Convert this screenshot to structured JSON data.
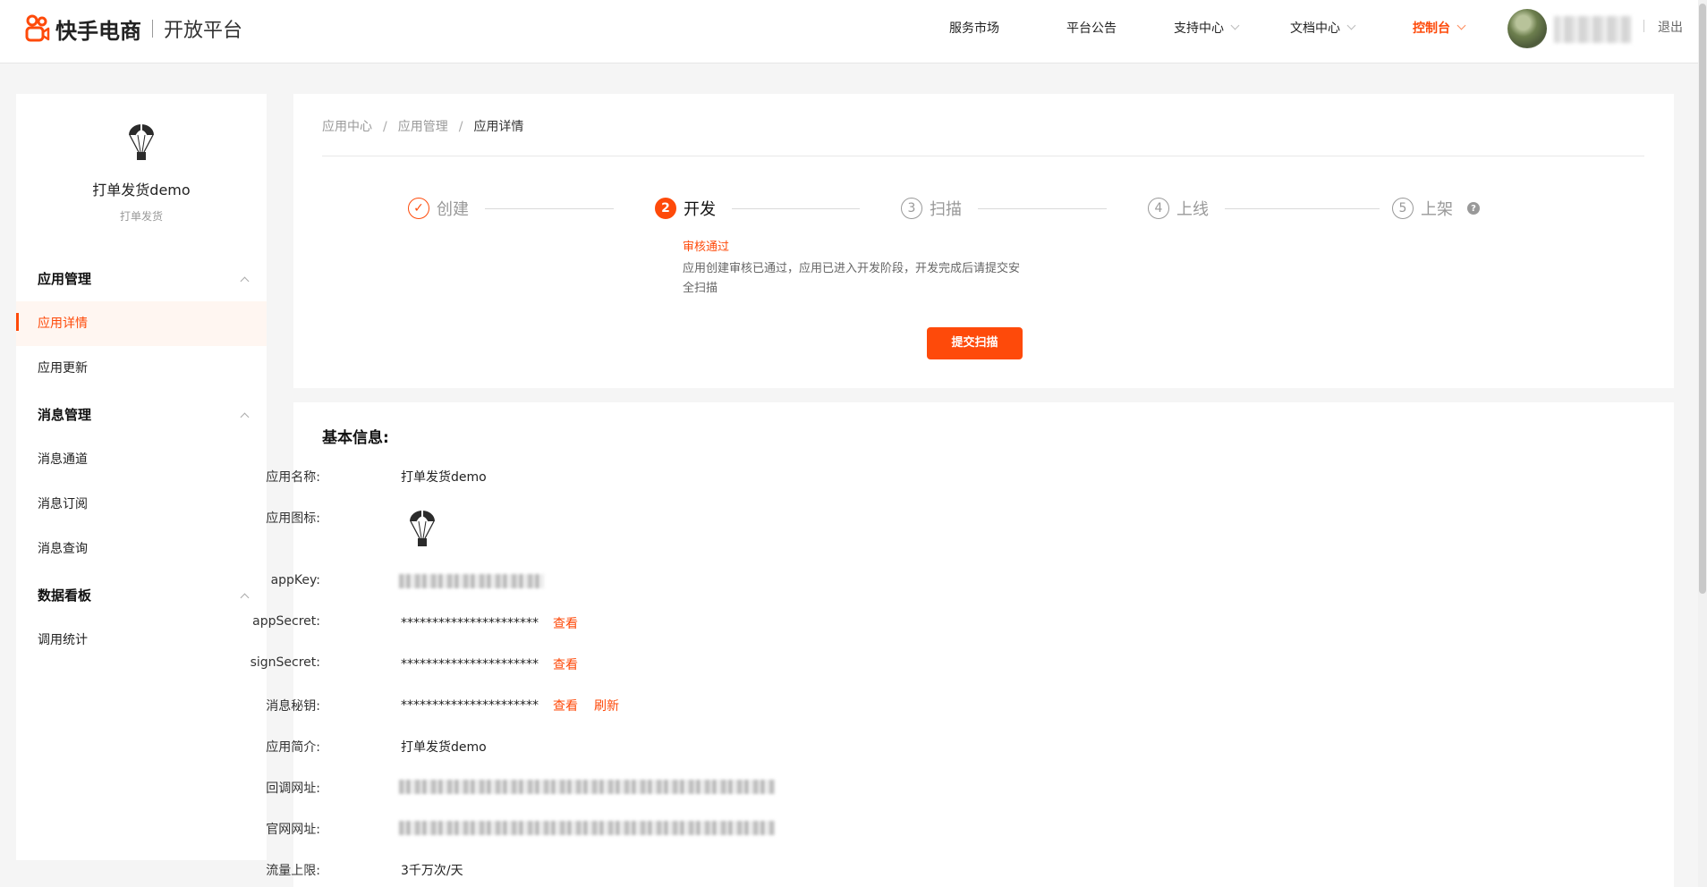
{
  "header": {
    "logo_text": "快手电商",
    "logo_sub": "开放平台",
    "nav": [
      {
        "label": "服务市场",
        "has_menu": false,
        "active": false
      },
      {
        "label": "平台公告",
        "has_menu": false,
        "active": false
      },
      {
        "label": "支持中心",
        "has_menu": true,
        "active": false
      },
      {
        "label": "文档中心",
        "has_menu": true,
        "active": false
      },
      {
        "label": "控制台",
        "has_menu": true,
        "active": true
      }
    ],
    "logout": "退出",
    "accent_color": "#fe4a0a"
  },
  "sidebar": {
    "app_name": "打单发货demo",
    "app_category": "打单发货",
    "groups": [
      {
        "title": "应用管理",
        "items": [
          {
            "label": "应用详情",
            "active": true
          },
          {
            "label": "应用更新",
            "active": false
          }
        ]
      },
      {
        "title": "消息管理",
        "items": [
          {
            "label": "消息通道",
            "active": false
          },
          {
            "label": "消息订阅",
            "active": false
          },
          {
            "label": "消息查询",
            "active": false
          }
        ]
      },
      {
        "title": "数据看板",
        "items": [
          {
            "label": "调用统计",
            "active": false
          }
        ]
      }
    ]
  },
  "breadcrumb": {
    "items": [
      "应用中心",
      "应用管理",
      "应用详情"
    ],
    "separator": "/"
  },
  "steps": {
    "items": [
      {
        "num": "✓",
        "label": "创建",
        "state": "done"
      },
      {
        "num": "2",
        "label": "开发",
        "state": "current"
      },
      {
        "num": "3",
        "label": "扫描",
        "state": "todo"
      },
      {
        "num": "4",
        "label": "上线",
        "state": "todo"
      },
      {
        "num": "5",
        "label": "上架",
        "state": "todo"
      }
    ],
    "help_icon": "?",
    "status_title": "审核通过",
    "status_desc": "应用创建审核已通过，应用已进入开发阶段，开发完成后请提交安全扫描",
    "submit_label": "提交扫描"
  },
  "basic_info": {
    "title": "基本信息:",
    "rows": [
      {
        "label": "应用名称:",
        "value": "打单发货demo"
      },
      {
        "label": "应用图标:",
        "value": ""
      },
      {
        "label": "appKey:",
        "value": ""
      },
      {
        "label": "appSecret:",
        "value": "**********************",
        "actions": [
          "查看"
        ]
      },
      {
        "label": "signSecret:",
        "value": "**********************",
        "actions": [
          "查看"
        ]
      },
      {
        "label": "消息秘钥:",
        "value": "**********************",
        "actions": [
          "查看",
          "刷新"
        ]
      },
      {
        "label": "应用简介:",
        "value": "打单发货demo"
      },
      {
        "label": "回调网址:",
        "value": ""
      },
      {
        "label": "官网网址:",
        "value": ""
      },
      {
        "label": "流量上限:",
        "value": "3千万次/天"
      }
    ]
  }
}
